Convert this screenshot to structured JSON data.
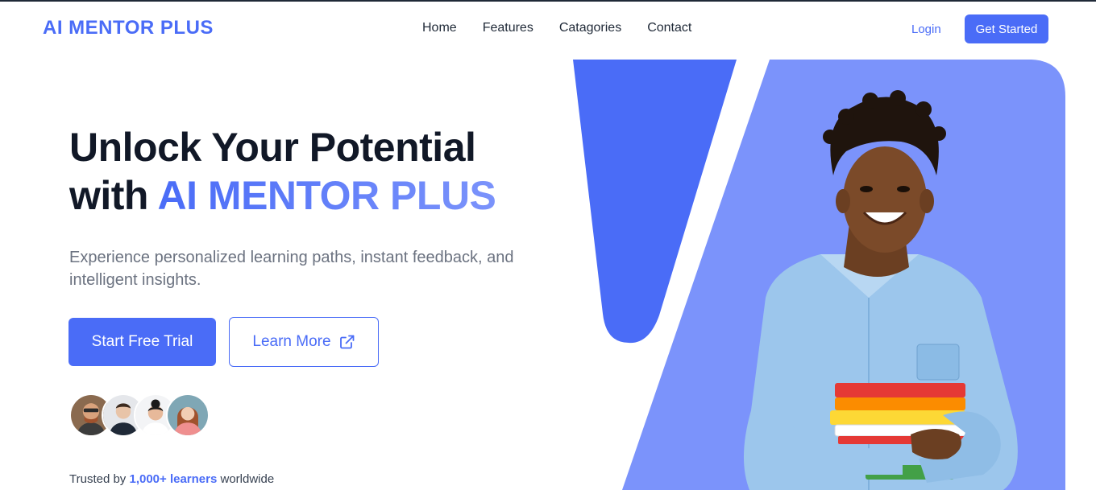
{
  "header": {
    "logo": "AI MENTOR PLUS",
    "nav": [
      "Home",
      "Features",
      "Catagories",
      "Contact"
    ],
    "login_label": "Login",
    "get_started_label": "Get Started"
  },
  "hero": {
    "headline_line1": "Unlock Your Potential",
    "headline_with": "with",
    "headline_brand": "AI MENTOR PLUS",
    "subtext": "Experience personalized learning paths, instant feedback, and intelligent insights.",
    "primary_cta": "Start Free Trial",
    "secondary_cta": "Learn More",
    "secondary_icon": "external-link-icon",
    "trusted_prefix": "Trusted by",
    "trusted_count": "1,000+ learners",
    "trusted_suffix": "worldwide"
  },
  "colors": {
    "brand": "#4a6cf7",
    "brand_light": "#7b93fb",
    "text_dark": "#111827",
    "text_muted": "#6b7280"
  }
}
